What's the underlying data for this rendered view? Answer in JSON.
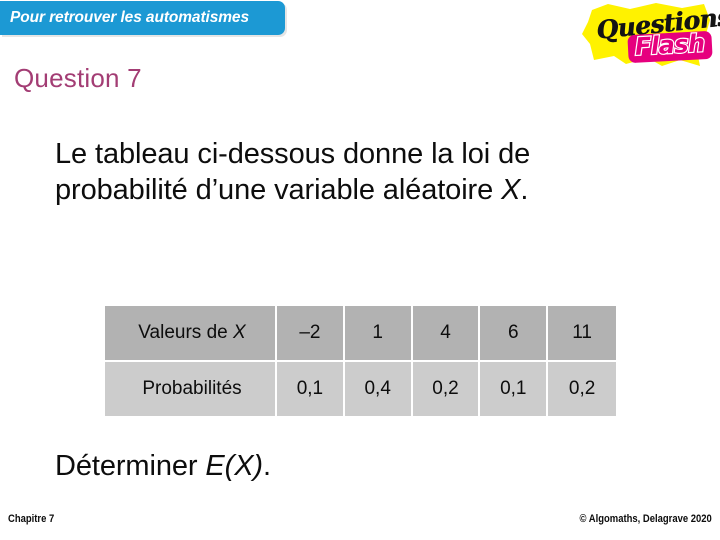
{
  "banner": {
    "text": "Pour retrouver les automatismes",
    "color": "#1C99D4"
  },
  "logo": {
    "line1": "Questions",
    "line2": "Flash",
    "bubble_color": "#FFF200",
    "flash_color": "#E6007E",
    "questions_color": "#141414"
  },
  "header": {
    "question_label": "Question 7",
    "question_color": "#A33D74"
  },
  "statement": {
    "part1": "Le tableau ci-dessous donne la loi de probabilité d’une variable aléatoire ",
    "variable": "X",
    "part2": "."
  },
  "table": {
    "row_labels": [
      "Valeurs de X",
      "Probabilités"
    ],
    "label_value_name": "Valeurs de ",
    "label_variable": "X",
    "label_probabilities": "Probabilités",
    "values": [
      "–2",
      "1",
      "4",
      "6",
      "11"
    ],
    "probabilities": [
      "0,1",
      "0,4",
      "0,2",
      "0,1",
      "0,2"
    ],
    "header_bg": "#B2B2B2",
    "body_bg": "#CCCCCC"
  },
  "closing": {
    "prefix": "Déterminer ",
    "expression": "E(X)",
    "suffix": "."
  },
  "footer": {
    "left": "Chapitre 7",
    "right": "© Algomaths, Delagrave 2020"
  }
}
